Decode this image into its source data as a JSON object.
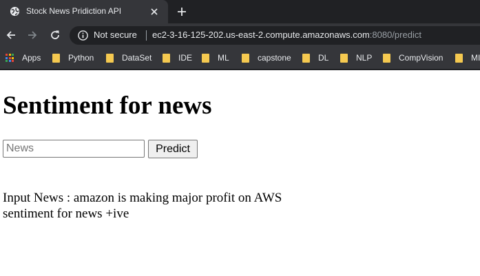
{
  "browser": {
    "tab": {
      "title": "Stock News Pridiction API",
      "favicon": "globe-icon",
      "close": "close-icon"
    },
    "new_tab": "plus-icon",
    "toolbar": {
      "back": "back-arrow-icon",
      "forward": "forward-arrow-icon",
      "reload": "reload-icon",
      "security_icon": "info-icon",
      "security_text": "Not secure",
      "url_host": "ec2-3-16-125-202.us-east-2.compute.amazonaws.com",
      "url_rest": ":8080/predict"
    },
    "bookmarks": [
      {
        "label": "Apps",
        "icon": "apps-grid-icon"
      },
      {
        "label": "Python",
        "icon": "folder-icon"
      },
      {
        "label": "DataSet",
        "icon": "folder-icon"
      },
      {
        "label": "IDE",
        "icon": "folder-icon"
      },
      {
        "label": "ML",
        "icon": "folder-icon"
      },
      {
        "label": "capstone",
        "icon": "folder-icon"
      },
      {
        "label": "DL",
        "icon": "folder-icon"
      },
      {
        "label": "NLP",
        "icon": "folder-icon"
      },
      {
        "label": "CompVision",
        "icon": "folder-icon"
      },
      {
        "label": "MI",
        "icon": "folder-icon"
      }
    ]
  },
  "page": {
    "heading": "Sentiment for news",
    "form": {
      "input_value": "",
      "input_placeholder": "News",
      "submit_label": "Predict"
    },
    "result": {
      "input_line": "Input News : amazon is making major profit on AWS",
      "sentiment_line": "sentiment for news +ive"
    }
  },
  "colors": {
    "tab_bg": "#35363a",
    "strip_bg": "#202124",
    "folder": "#f5c950",
    "text_light": "#e8eaed"
  }
}
